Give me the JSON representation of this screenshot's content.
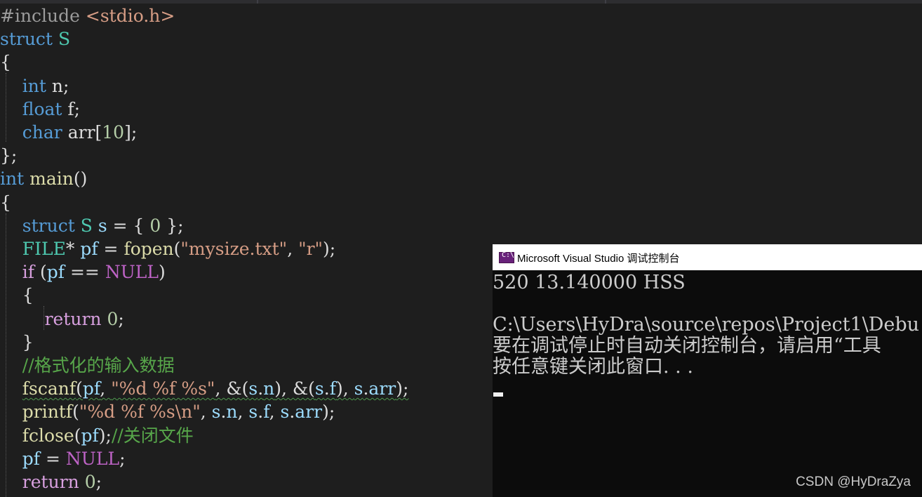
{
  "editor": {
    "lines": [
      {
        "id": "include",
        "segments": [
          {
            "t": "#include ",
            "c": "pp"
          },
          {
            "t": "<stdio.h>",
            "c": "inc"
          }
        ]
      },
      {
        "id": "struct-decl",
        "segments": [
          {
            "t": "struct ",
            "c": "kw"
          },
          {
            "t": "S",
            "c": "ty"
          }
        ]
      },
      {
        "id": "brace-open-1",
        "segments": [
          {
            "t": "{",
            "c": "txt"
          }
        ]
      },
      {
        "id": "field-n",
        "segments": [
          {
            "t": "    "
          },
          {
            "t": "int",
            "c": "kw"
          },
          {
            "t": " n;",
            "c": "txt"
          }
        ]
      },
      {
        "id": "field-f",
        "segments": [
          {
            "t": "    "
          },
          {
            "t": "float",
            "c": "kw"
          },
          {
            "t": " f;",
            "c": "txt"
          }
        ]
      },
      {
        "id": "field-arr",
        "segments": [
          {
            "t": "    "
          },
          {
            "t": "char",
            "c": "kw"
          },
          {
            "t": " arr[",
            "c": "txt"
          },
          {
            "t": "10",
            "c": "num"
          },
          {
            "t": "];",
            "c": "txt"
          }
        ]
      },
      {
        "id": "brace-close-1",
        "segments": [
          {
            "t": "};",
            "c": "txt"
          }
        ]
      },
      {
        "id": "main-decl",
        "segments": [
          {
            "t": "int",
            "c": "kw"
          },
          {
            "t": " ",
            "c": "txt"
          },
          {
            "t": "main",
            "c": "fn"
          },
          {
            "t": "()",
            "c": "txt"
          }
        ]
      },
      {
        "id": "brace-open-2",
        "segments": [
          {
            "t": "{",
            "c": "txt"
          }
        ]
      },
      {
        "id": "struct-init",
        "segments": [
          {
            "t": "    "
          },
          {
            "t": "struct ",
            "c": "kw"
          },
          {
            "t": "S",
            "c": "ty"
          },
          {
            "t": " ",
            "c": "txt"
          },
          {
            "t": "s",
            "c": "var"
          },
          {
            "t": " = { ",
            "c": "txt"
          },
          {
            "t": "0",
            "c": "num"
          },
          {
            "t": " };",
            "c": "txt"
          }
        ]
      },
      {
        "id": "fopen-line",
        "segments": [
          {
            "t": "    "
          },
          {
            "t": "FILE",
            "c": "ty"
          },
          {
            "t": "* ",
            "c": "txt"
          },
          {
            "t": "pf",
            "c": "var"
          },
          {
            "t": " = ",
            "c": "txt"
          },
          {
            "t": "fopen",
            "c": "fn"
          },
          {
            "t": "(",
            "c": "txt"
          },
          {
            "t": "\"mysize.txt\"",
            "c": "str"
          },
          {
            "t": ", ",
            "c": "txt"
          },
          {
            "t": "\"r\"",
            "c": "str"
          },
          {
            "t": ");",
            "c": "txt"
          }
        ]
      },
      {
        "id": "if-line",
        "segments": [
          {
            "t": "    "
          },
          {
            "t": "if",
            "c": "ctl"
          },
          {
            "t": " (",
            "c": "txt"
          },
          {
            "t": "pf",
            "c": "var"
          },
          {
            "t": " == ",
            "c": "txt"
          },
          {
            "t": "NULL",
            "c": "mac"
          },
          {
            "t": ")",
            "c": "txt"
          }
        ]
      },
      {
        "id": "brace-open-3",
        "segments": [
          {
            "t": "    "
          },
          {
            "t": "{",
            "c": "txt"
          }
        ]
      },
      {
        "id": "return-0-inner",
        "segments": [
          {
            "t": "        "
          },
          {
            "t": "return",
            "c": "ctl"
          },
          {
            "t": " ",
            "c": "txt"
          },
          {
            "t": "0",
            "c": "num"
          },
          {
            "t": ";",
            "c": "txt"
          }
        ]
      },
      {
        "id": "brace-close-3",
        "segments": [
          {
            "t": "    "
          },
          {
            "t": "}",
            "c": "txt"
          }
        ]
      },
      {
        "id": "comment-format",
        "segments": [
          {
            "t": "    "
          },
          {
            "t": "//格式化的输入数据",
            "c": "cmt"
          }
        ]
      },
      {
        "id": "fscanf-line",
        "squiggle": true,
        "segments": [
          {
            "t": "    "
          },
          {
            "t": "fscanf",
            "c": "fn"
          },
          {
            "t": "(",
            "c": "txt"
          },
          {
            "t": "pf",
            "c": "var"
          },
          {
            "t": ", ",
            "c": "txt"
          },
          {
            "t": "\"%d %f %s\"",
            "c": "str"
          },
          {
            "t": ", &(",
            "c": "txt"
          },
          {
            "t": "s",
            "c": "var"
          },
          {
            "t": ".",
            "c": "txt"
          },
          {
            "t": "n",
            "c": "var"
          },
          {
            "t": "), &(",
            "c": "txt"
          },
          {
            "t": "s",
            "c": "var"
          },
          {
            "t": ".",
            "c": "txt"
          },
          {
            "t": "f",
            "c": "var"
          },
          {
            "t": "), ",
            "c": "txt"
          },
          {
            "t": "s",
            "c": "var"
          },
          {
            "t": ".",
            "c": "txt"
          },
          {
            "t": "arr",
            "c": "var"
          },
          {
            "t": ");",
            "c": "txt"
          }
        ]
      },
      {
        "id": "printf-line",
        "segments": [
          {
            "t": "    "
          },
          {
            "t": "printf",
            "c": "fn"
          },
          {
            "t": "(",
            "c": "txt"
          },
          {
            "t": "\"%d %f %s\\n\"",
            "c": "str"
          },
          {
            "t": ", ",
            "c": "txt"
          },
          {
            "t": "s",
            "c": "var"
          },
          {
            "t": ".",
            "c": "txt"
          },
          {
            "t": "n",
            "c": "var"
          },
          {
            "t": ", ",
            "c": "txt"
          },
          {
            "t": "s",
            "c": "var"
          },
          {
            "t": ".",
            "c": "txt"
          },
          {
            "t": "f",
            "c": "var"
          },
          {
            "t": ", ",
            "c": "txt"
          },
          {
            "t": "s",
            "c": "var"
          },
          {
            "t": ".",
            "c": "txt"
          },
          {
            "t": "arr",
            "c": "var"
          },
          {
            "t": ");",
            "c": "txt"
          }
        ]
      },
      {
        "id": "fclose-line",
        "segments": [
          {
            "t": "    "
          },
          {
            "t": "fclose",
            "c": "fn"
          },
          {
            "t": "(",
            "c": "txt"
          },
          {
            "t": "pf",
            "c": "var"
          },
          {
            "t": ");",
            "c": "txt"
          },
          {
            "t": "//关闭文件",
            "c": "cmt"
          }
        ]
      },
      {
        "id": "pf-null-line",
        "segments": [
          {
            "t": "    "
          },
          {
            "t": "pf",
            "c": "var"
          },
          {
            "t": " = ",
            "c": "txt"
          },
          {
            "t": "NULL",
            "c": "mac"
          },
          {
            "t": ";",
            "c": "txt"
          }
        ]
      },
      {
        "id": "return-0-main",
        "segments": [
          {
            "t": "    "
          },
          {
            "t": "return",
            "c": "ctl"
          },
          {
            "t": " ",
            "c": "txt"
          },
          {
            "t": "0",
            "c": "num"
          },
          {
            "t": ";",
            "c": "txt"
          }
        ]
      }
    ]
  },
  "console": {
    "title": "Microsoft Visual Studio 调试控制台",
    "icon": "console-app-icon",
    "icon_text": "C:\\",
    "output_lines": [
      "520 13.140000 HSS",
      "",
      "C:\\Users\\HyDra\\source\\repos\\Project1\\Debu",
      "要在调试停止时自动关闭控制台，请启用“工具",
      "按任意键关闭此窗口. . ."
    ]
  },
  "watermark": "CSDN @HyDraZya",
  "colors": {
    "editor_bg": "#1e1e1e",
    "keyword": "#569cd6",
    "type": "#4ec9b0",
    "string": "#d69d85",
    "function": "#dcdcaa",
    "variable": "#9cdcfe",
    "macro": "#bd63c5",
    "control": "#d8a0df",
    "comment": "#57a64a",
    "console_bg": "#0c0c0c"
  }
}
